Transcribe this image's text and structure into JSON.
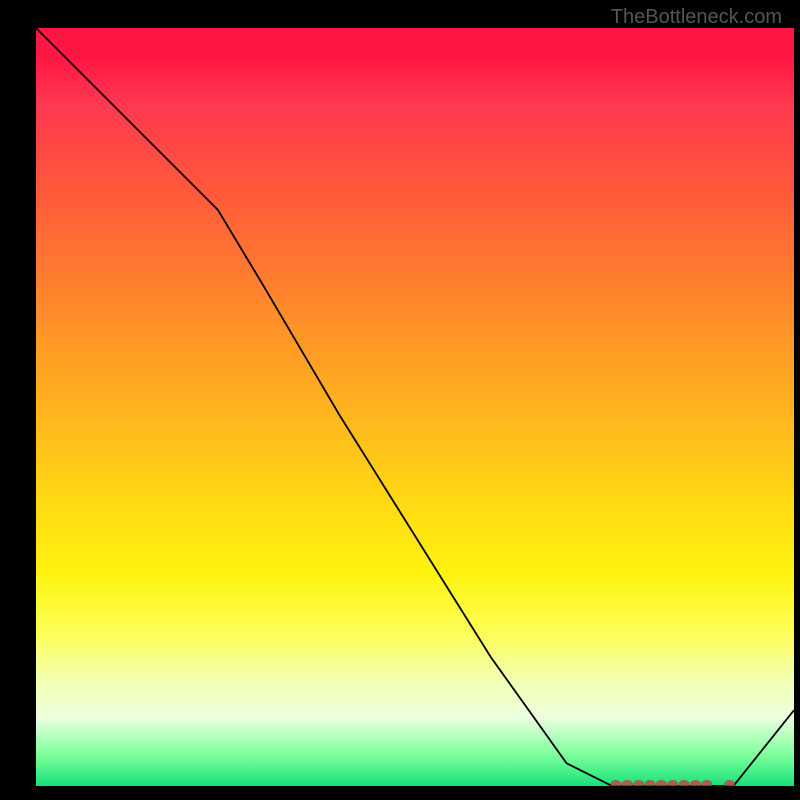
{
  "watermark": "TheBottleneck.com",
  "chart_data": {
    "type": "line",
    "title": "",
    "xlabel": "",
    "ylabel": "",
    "xlim": [
      0,
      100
    ],
    "ylim": [
      0,
      100
    ],
    "legend": false,
    "grid": false,
    "gradient": {
      "orientation": "vertical",
      "stops": [
        {
          "pos": 0,
          "color": "#ff1744"
        },
        {
          "pos": 40,
          "color": "#ff7a30"
        },
        {
          "pos": 70,
          "color": "#fff310"
        },
        {
          "pos": 100,
          "color": "#18e07a"
        }
      ]
    },
    "series": [
      {
        "name": "curve",
        "color": "#000000",
        "x": [
          0,
          5,
          10,
          15,
          20,
          24,
          30,
          40,
          50,
          60,
          70,
          76,
          80,
          84,
          88,
          92,
          100
        ],
        "y": [
          100,
          95,
          90,
          85,
          80,
          76,
          66,
          49,
          33,
          17,
          3,
          0,
          0,
          0,
          0,
          0,
          10
        ]
      },
      {
        "name": "bottom-marks",
        "color": "#cc3a3a",
        "x": [
          76.5,
          78,
          79.5,
          81,
          82.5,
          84,
          85.5,
          87,
          88.5,
          91.5
        ],
        "y": [
          0,
          0,
          0,
          0,
          0,
          0,
          0,
          0,
          0,
          0
        ]
      }
    ]
  }
}
